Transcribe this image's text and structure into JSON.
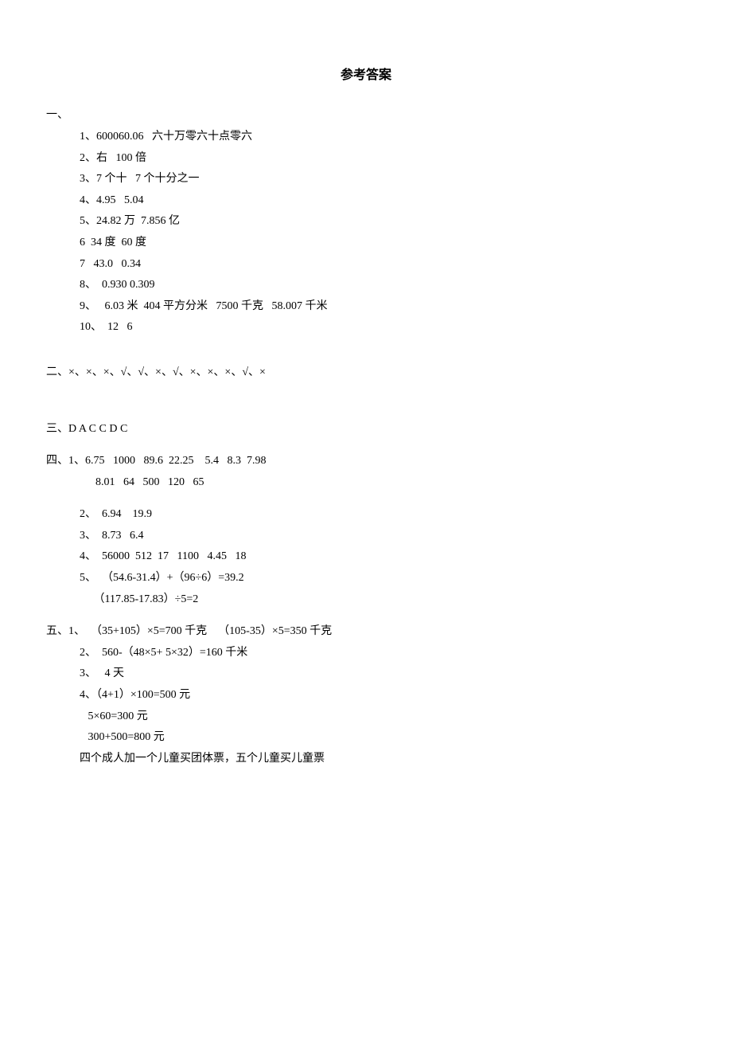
{
  "title": "参考答案",
  "sections": {
    "one": {
      "label": "一、",
      "items": [
        "1、600060.06   六十万零六十点零六",
        "2、右   100 倍",
        "3、7 个十   7 个十分之一",
        "4、4.95   5.04",
        "5、24.82 万  7.856 亿",
        "6  34 度  60 度",
        "7   43.0   0.34",
        "8、  0.930 0.309",
        "9、   6.03 米  404 平方分米   7500 千克   58.007 千米",
        "10、  12   6"
      ]
    },
    "two": {
      "text": "二、×、×、×、√、√、×、√、×、×、×、√、×"
    },
    "three": {
      "text": "三、D A C C D C"
    },
    "four": {
      "label": "四、",
      "line1": "1、6.75   1000   89.6  22.25    5.4   8.3  7.98",
      "line2": "8.01   64   500   120   65",
      "items": [
        "2、  6.94    19.9",
        "3、  8.73   6.4",
        "4、  56000  512  17   1100   4.45   18",
        "5、  （54.6-31.4）+（96÷6）=39.2",
        "     （117.85-17.83）÷5=2"
      ]
    },
    "five": {
      "label": "五、",
      "line1": "1、  （35+105）×5=700 千克    （105-35）×5=350 千克",
      "items": [
        "2、  560-（48×5+ 5×32）=160 千米",
        "3、   4 天",
        "4、（4+1）×100=500 元",
        "   5×60=300 元",
        "   300+500=800 元",
        "四个成人加一个儿童买团体票，五个儿童买儿童票"
      ]
    }
  }
}
